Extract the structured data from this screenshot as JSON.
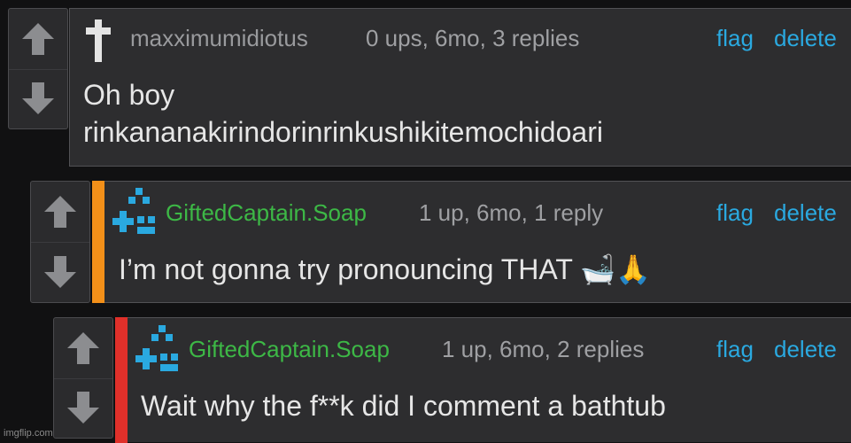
{
  "comments": [
    {
      "username": "maxximumidiotus",
      "meta": "0 ups, 6mo, 3 replies",
      "flag": "flag",
      "delete": "delete",
      "text_line1": "Oh boy",
      "text_line2": "rinkananakirindorinrinkushikitemochidoari",
      "avatar_icon": "cross-icon"
    },
    {
      "username": "GiftedCaptain.Soap",
      "meta": "1 up, 6mo, 1 reply",
      "flag": "flag",
      "delete": "delete",
      "text": "I’m not gonna try pronouncing THAT",
      "emoji": [
        "🛁",
        "🙏"
      ],
      "bar_color": "#f39019",
      "avatar_icon": "pixel-avatar-icon"
    },
    {
      "username": "GiftedCaptain.Soap",
      "meta": "1 up, 6mo, 2 replies",
      "flag": "flag",
      "delete": "delete",
      "text": "Wait why the f**k did I comment a bathtub",
      "bar_color": "#e0302a",
      "avatar_icon": "pixel-avatar-icon"
    }
  ],
  "watermark": "imgflip.com",
  "colors": {
    "username_green": "#3db846",
    "action_blue": "#2aa9e0"
  }
}
